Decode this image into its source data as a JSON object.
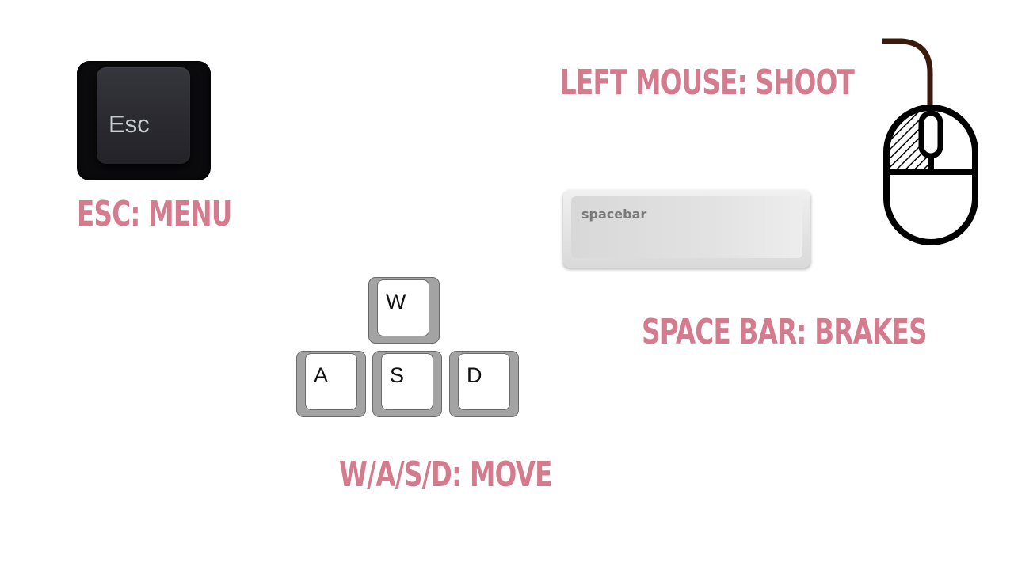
{
  "controls": {
    "esc": {
      "key_label": "Esc",
      "caption": "ESC: MENU"
    },
    "wasd": {
      "keys": [
        "W",
        "A",
        "S",
        "D"
      ],
      "caption": "W/A/S/D: MOVE"
    },
    "spacebar": {
      "key_label": "spacebar",
      "caption": "SPACE BAR: BRAKES"
    },
    "mouse": {
      "caption": "LEFT MOUSE: SHOOT"
    }
  },
  "colors": {
    "caption": "#d47b8e",
    "mouse_cable": "#3a1a0c"
  }
}
